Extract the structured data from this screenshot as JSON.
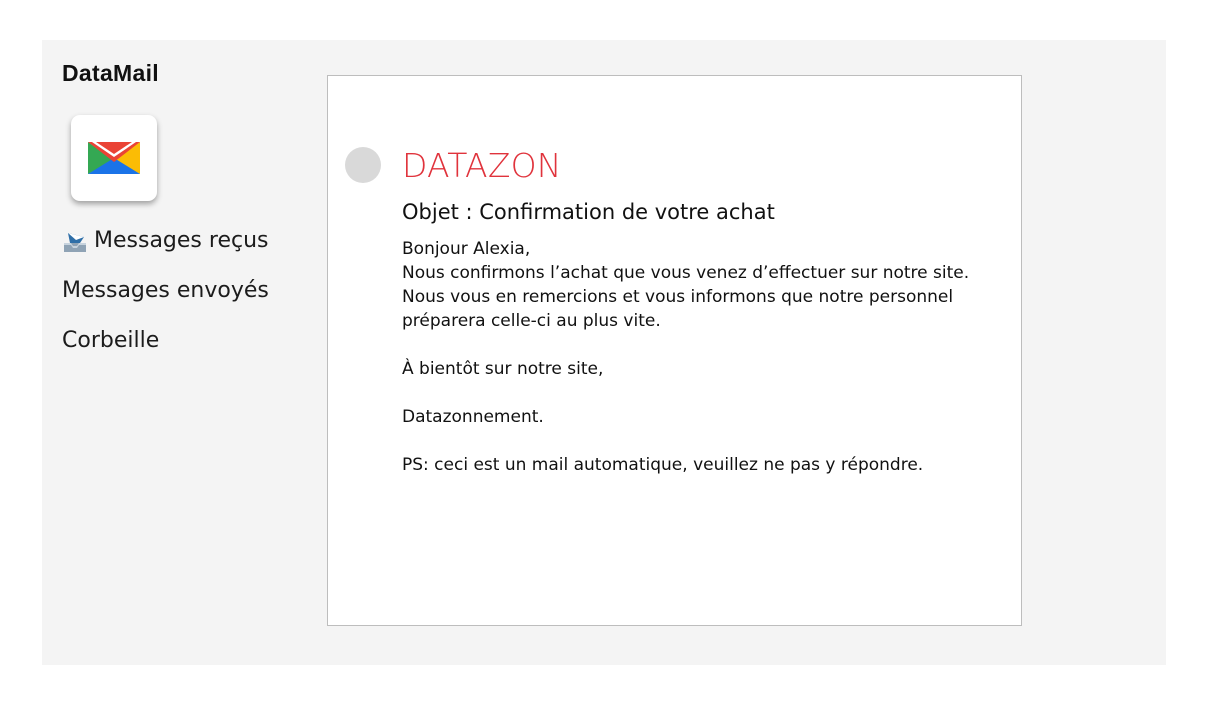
{
  "app": {
    "title": "DataMail"
  },
  "nav": {
    "items": [
      {
        "label": "Messages reçus",
        "icon": "inbox-tray-icon"
      },
      {
        "label": "Messages envoyés"
      },
      {
        "label": "Corbeille"
      }
    ]
  },
  "email": {
    "sender": "DATAZON",
    "subject": "Objet : Confirmation de votre achat",
    "greeting": "Bonjour Alexia,",
    "paragraph": "Nous confirmons l’achat que vous venez d’effectuer sur notre site. Nous vous en remercions et vous informons que notre personnel préparera celle-ci au plus vite.",
    "closing": "À bientôt sur notre site,",
    "signature": "Datazonnement.",
    "ps": "PS: ceci est un mail automatique, veuillez ne pas y répondre."
  },
  "colors": {
    "sender": "#e0333c",
    "app_background": "#f4f4f4",
    "avatar": "#d9d9d9"
  }
}
